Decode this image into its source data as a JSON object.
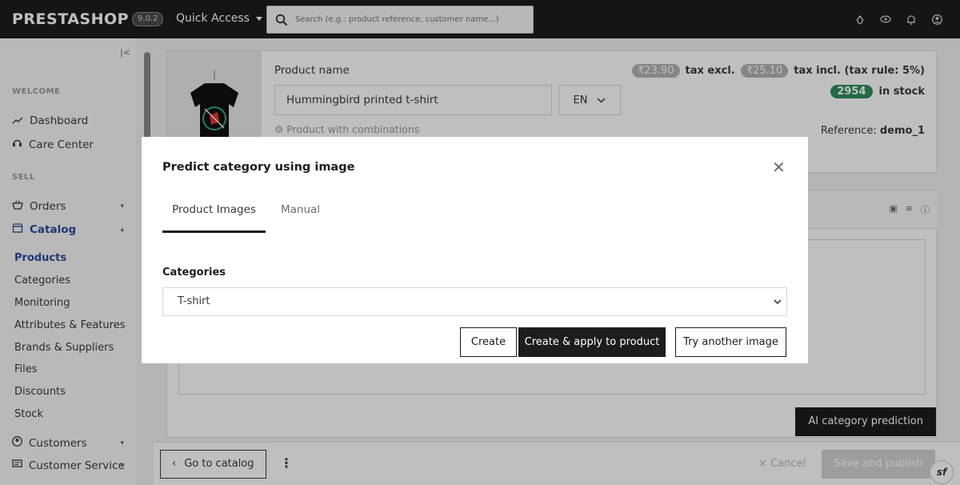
{
  "header": {
    "logo": "PRESTASHOP",
    "version": "9.0.2",
    "quick_access": "Quick Access",
    "search_placeholder": "Search (e.g.: product reference, customer name...)"
  },
  "sidebar": {
    "section_welcome": "WELCOME",
    "dashboard": "Dashboard",
    "care_center": "Care Center",
    "section_sell": "SELL",
    "orders": "Orders",
    "catalog": "Catalog",
    "catalog_items": [
      "Products",
      "Categories",
      "Monitoring",
      "Attributes & Features",
      "Brands & Suppliers",
      "Files",
      "Discounts",
      "Stock"
    ],
    "customers": "Customers",
    "customer_service": "Customer Service"
  },
  "product": {
    "name_label": "Product name",
    "name_value": "Hummingbird printed t-shirt",
    "language": "EN",
    "type": "Product with combinations",
    "price_excl": "₹23.90",
    "price_excl_label": "tax excl.",
    "price_incl": "₹25.10",
    "price_incl_label": "tax incl. (tax rule: 5%)",
    "stock_qty": "2954",
    "stock_label": "in stock",
    "reference_label": "Reference:",
    "reference_value": "demo_1"
  },
  "main": {
    "ai_button": "AI category prediction"
  },
  "footer": {
    "go_to_catalog": "Go to catalog",
    "cancel": "Cancel",
    "save": "Save and publish"
  },
  "modal": {
    "title": "Predict category using image",
    "tabs": [
      "Product Images",
      "Manual"
    ],
    "categories_label": "Categories",
    "selected_category": "T-shirt",
    "buttons": {
      "create": "Create",
      "apply": "Create & apply to product",
      "try_another": "Try another image"
    }
  },
  "colors": {
    "header_bg": "#1d1d1b",
    "active_nav": "#2a4a9c",
    "stock_badge": "#2b8f5b"
  }
}
